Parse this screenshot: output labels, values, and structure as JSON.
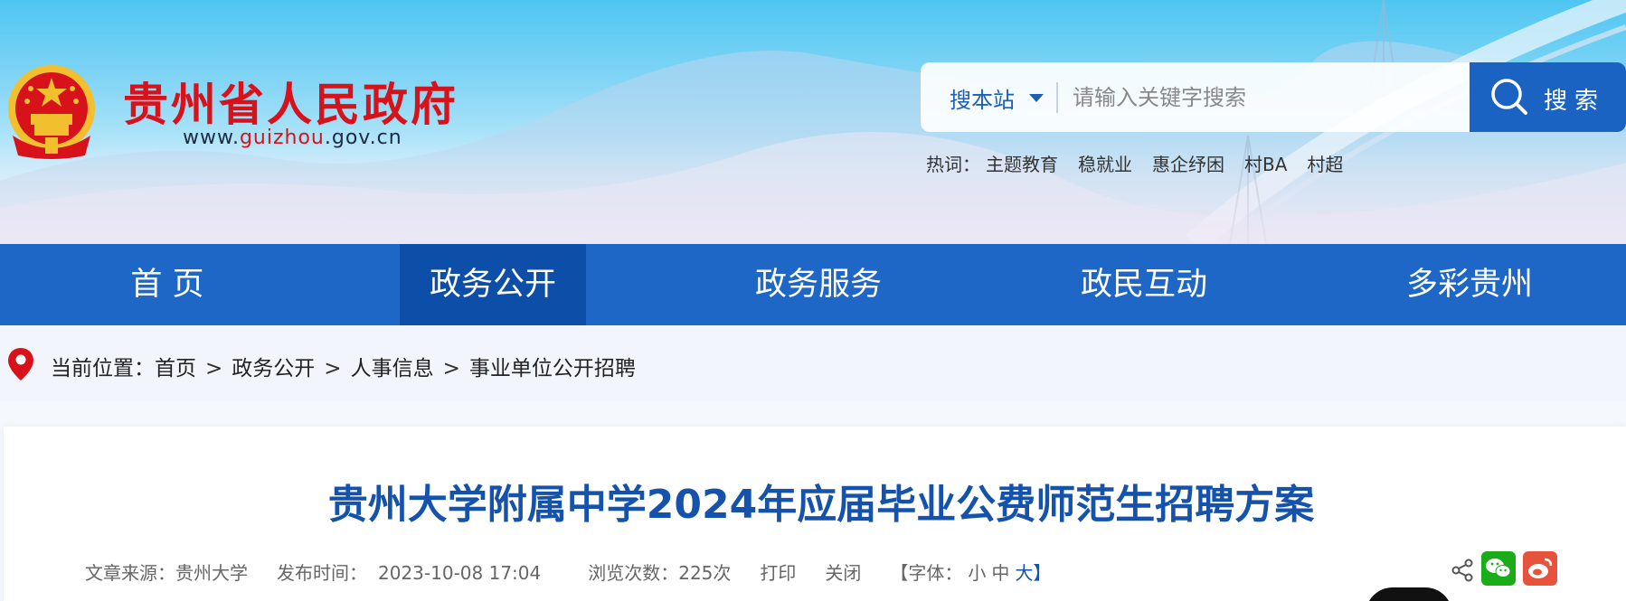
{
  "header": {
    "site_title": "贵州省人民政府",
    "domain_prefix": "www.",
    "domain_highlight": "guizhou",
    "domain_suffix": ".gov.cn"
  },
  "search": {
    "scope": "搜本站",
    "placeholder": "请输入关键字搜索",
    "button_label": "搜索"
  },
  "hotwords": {
    "label": "热词：",
    "items": [
      "主题教育",
      "稳就业",
      "惠企纾困",
      "村BA",
      "村超"
    ]
  },
  "nav": {
    "items": [
      "首 页",
      "政务公开",
      "政务服务",
      "政民互动",
      "多彩贵州"
    ],
    "active_index": 1
  },
  "breadcrumb": {
    "label": "当前位置：",
    "items": [
      "首页",
      "政务公开",
      "人事信息",
      "事业单位公开招聘"
    ],
    "separator": ">"
  },
  "article": {
    "title": "贵州大学附属中学2024年应届毕业公费师范生招聘方案",
    "source_label": "文章来源：",
    "source": "贵州大学",
    "publish_label": "发布时间：",
    "publish_time": "2023-10-08 17:04",
    "views_label": "浏览次数：",
    "views": "225次",
    "print": "打印",
    "close": "关闭",
    "font_size_label": "【字体：",
    "font_small": "小",
    "font_medium": "中",
    "font_large": "大】"
  },
  "colors": {
    "brand_red": "#d8121a",
    "nav_blue": "#1f67c7",
    "nav_active": "#0d4fa8",
    "title_blue": "#1552ab"
  },
  "icons": [
    "national-emblem",
    "chevron-down-icon",
    "search-icon",
    "location-pin-icon",
    "share-icon",
    "wechat-icon",
    "weibo-icon"
  ]
}
